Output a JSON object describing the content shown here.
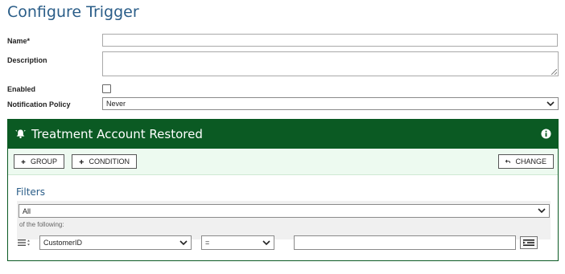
{
  "page": {
    "title": "Configure Trigger"
  },
  "form": {
    "name_label": "Name*",
    "name_value": "",
    "description_label": "Description",
    "description_value": "",
    "enabled_label": "Enabled",
    "enabled_checked": false,
    "notification_label": "Notification Policy",
    "notification_value": "Never"
  },
  "panel": {
    "title": "Treatment Account Restored",
    "header_color": "#0b5a23",
    "toolbar": {
      "group_label": "GROUP",
      "condition_label": "CONDITION",
      "change_label": "CHANGE"
    },
    "filters": {
      "title": "Filters",
      "match_value": "All",
      "of_following": "of the following:",
      "condition": {
        "field": "CustomerID",
        "operator": "=",
        "value": ""
      }
    }
  },
  "icons": {
    "bell": "bell-icon",
    "info": "info-icon",
    "plus": "plus-icon",
    "undo": "undo-icon",
    "drag": "drag-handle-icon",
    "chevron": "chevron-down-icon",
    "value_picker": "value-picker-icon"
  }
}
